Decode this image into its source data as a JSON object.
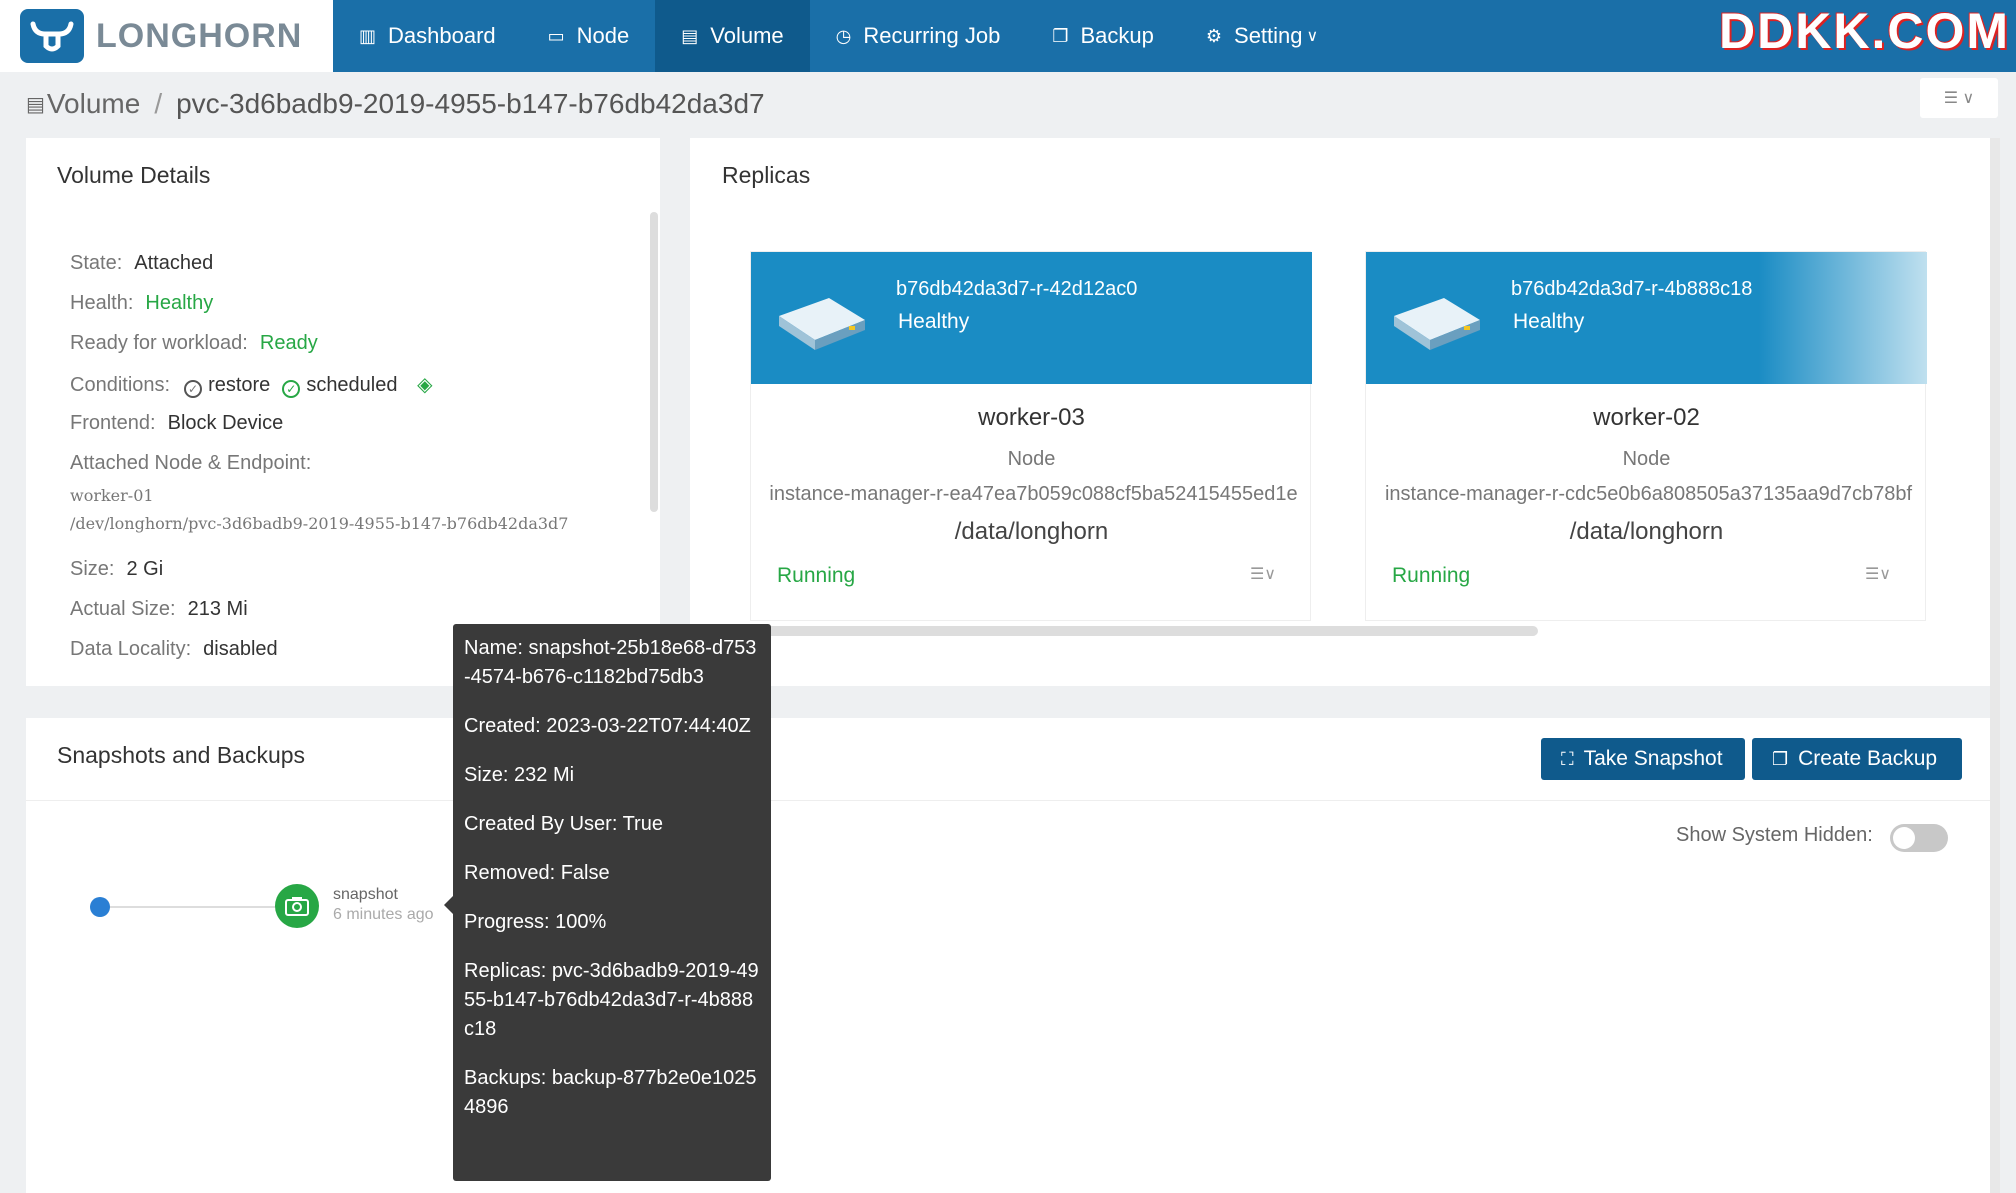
{
  "app": {
    "logo_text": "LONGHORN",
    "watermark": "DDKK.COM"
  },
  "nav": [
    {
      "label": "Dashboard",
      "icon": "bar-chart-icon"
    },
    {
      "label": "Node",
      "icon": "laptop-icon"
    },
    {
      "label": "Volume",
      "icon": "database-icon",
      "active": true
    },
    {
      "label": "Recurring Job",
      "icon": "clock-icon"
    },
    {
      "label": "Backup",
      "icon": "copy-icon"
    },
    {
      "label": "Setting",
      "icon": "gear-icon",
      "has_dropdown": true
    }
  ],
  "breadcrumb": {
    "root": "Volume",
    "separator": "/",
    "current": "pvc-3d6badb9-2019-4955-b147-b76db42da3d7"
  },
  "volume_details": {
    "title": "Volume Details",
    "state_label": "State:",
    "state": "Attached",
    "health_label": "Health:",
    "health": "Healthy",
    "ready_label": "Ready for workload:",
    "ready": "Ready",
    "conditions_label": "Conditions:",
    "conditions": [
      "restore",
      "scheduled"
    ],
    "frontend_label": "Frontend:",
    "frontend": "Block Device",
    "endpoint_label": "Attached Node & Endpoint:",
    "node": "worker-01",
    "endpoint": "/dev/longhorn/pvc-3d6badb9-2019-4955-b147-b76db42da3d7",
    "size_label": "Size:",
    "size": "2 Gi",
    "actual_size_label": "Actual Size:",
    "actual_size": "213 Mi",
    "locality_label": "Data Locality:",
    "locality": "disabled"
  },
  "replicas": {
    "title": "Replicas",
    "items": [
      {
        "name": "b76db42da3d7-r-42d12ac0",
        "health": "Healthy",
        "host": "worker-03",
        "node_label": "Node",
        "instance_manager": "instance-manager-r-ea47ea7b059c088cf5ba52415455ed1e",
        "path": "/data/longhorn",
        "state": "Running"
      },
      {
        "name": "b76db42da3d7-r-4b888c18",
        "health": "Healthy",
        "host": "worker-02",
        "node_label": "Node",
        "instance_manager": "instance-manager-r-cdc5e0b6a808505a37135aa9d7cb78bf",
        "path": "/data/longhorn",
        "state": "Running"
      }
    ]
  },
  "snapshots": {
    "title": "Snapshots and Backups",
    "take_snapshot": "Take Snapshot",
    "create_backup": "Create Backup",
    "show_hidden_label": "Show System Hidden:",
    "show_hidden": false,
    "snapshot_name": "snapshot",
    "snapshot_time": "6 minutes ago"
  },
  "tooltip": {
    "name": "Name: snapshot-25b18e68-d753-4574-b676-c1182bd75db3",
    "created": "Created: 2023-03-22T07:44:40Z",
    "size": "Size: 232 Mi",
    "created_by_user": "Created By User: True",
    "removed": "Removed: False",
    "progress": "Progress: 100%",
    "replicas": "Replicas: pvc-3d6badb9-2019-4955-b147-b76db42da3d7-r-4b888c18",
    "backups": "Backups: backup-877b2e0e10254896"
  },
  "colors": {
    "nav": "#1a6fa8",
    "nav_active": "#0f5a8c",
    "healthy": "#27a745",
    "replica_head": "#1a8cc4"
  }
}
